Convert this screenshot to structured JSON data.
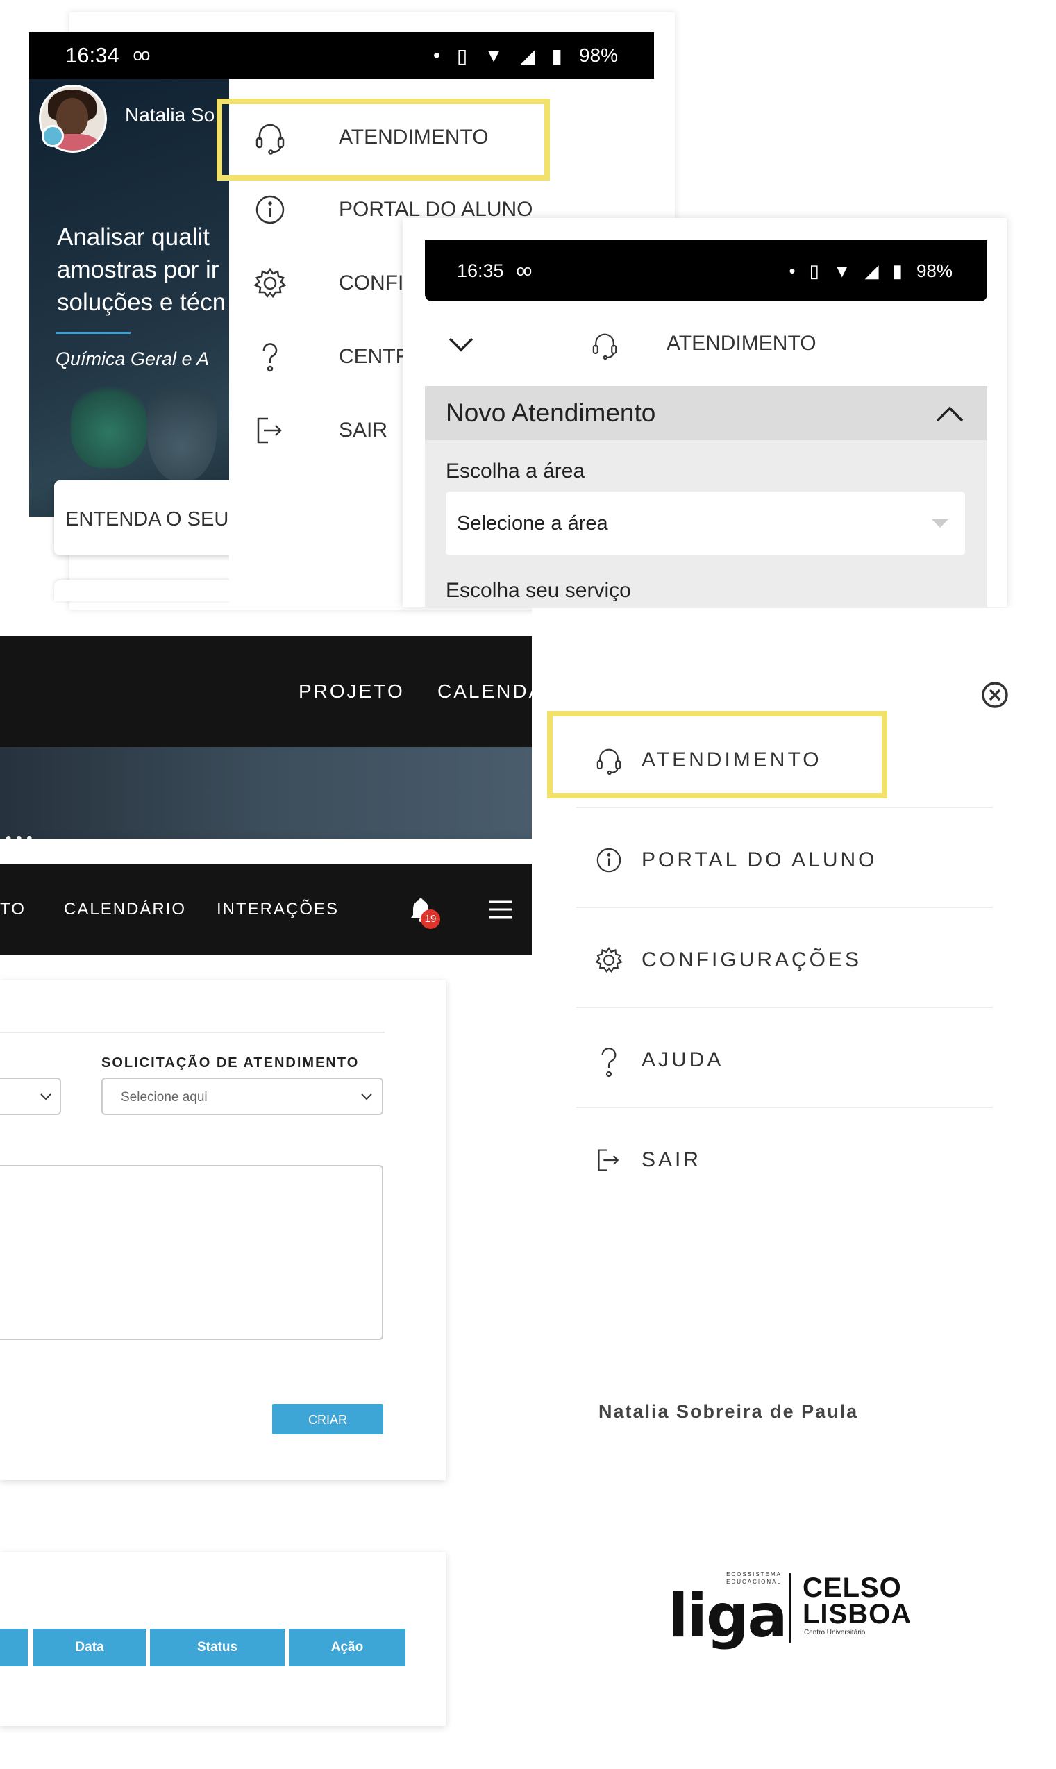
{
  "phone1": {
    "status": {
      "time": "16:34",
      "voicemail": "oo",
      "battery": "98%"
    },
    "user_name": "Natalia So",
    "hero_text_lines": [
      "Analisar qualit",
      "amostras por ir",
      "soluções e técn"
    ],
    "hero_subtitle": "Química Geral e A",
    "card_text": "ENTENDA O SEU",
    "menu": [
      {
        "label": "ATENDIMENTO",
        "icon": "headset-icon"
      },
      {
        "label": "PORTAL DO ALUNO",
        "icon": "info-icon"
      },
      {
        "label": "CONFI",
        "icon": "gear-icon"
      },
      {
        "label": "CENTR",
        "icon": "question-icon"
      },
      {
        "label": "SAIR",
        "icon": "logout-icon"
      }
    ]
  },
  "phone2": {
    "status": {
      "time": "16:35",
      "voicemail": "oo",
      "battery": "98%"
    },
    "header_title": "ATENDIMENTO",
    "section_title": "Novo Atendimento",
    "area_label": "Escolha a área",
    "area_value": "Selecione a área",
    "service_label": "Escolha seu serviço"
  },
  "desktop": {
    "nav1": [
      "PROJETO",
      "CALENDÁ"
    ],
    "nav2": [
      "TO",
      "CALENDÁRIO",
      "INTERAÇÕES"
    ],
    "notification_count": "19",
    "request_label": "SOLICITAÇÃO DE ATENDIMENTO",
    "request_placeholder": "Selecione aqui",
    "create_button": "CRIAR",
    "table_headers": [
      "Data",
      "Status",
      "Ação"
    ]
  },
  "side_menu": {
    "items": [
      {
        "label": "ATENDIMENTO",
        "icon": "headset-icon"
      },
      {
        "label": "PORTAL DO ALUNO",
        "icon": "info-icon"
      },
      {
        "label": "CONFIGURAÇÕES",
        "icon": "gear-icon"
      },
      {
        "label": "AJUDA",
        "icon": "question-icon"
      },
      {
        "label": "SAIR",
        "icon": "logout-icon"
      }
    ],
    "user_name": "Natalia Sobreira de Paula",
    "logo": {
      "liga": "liga",
      "ecosystem": "ECOSSISTEMA EDUCACIONAL",
      "celso": "CELSO",
      "lisboa": "LISBOA",
      "centro": "Centro Universitário"
    }
  },
  "colors": {
    "highlight": "#f2e16b",
    "accent": "#3ea6d6",
    "nav_bg": "#141414",
    "badge": "#e0342b"
  }
}
